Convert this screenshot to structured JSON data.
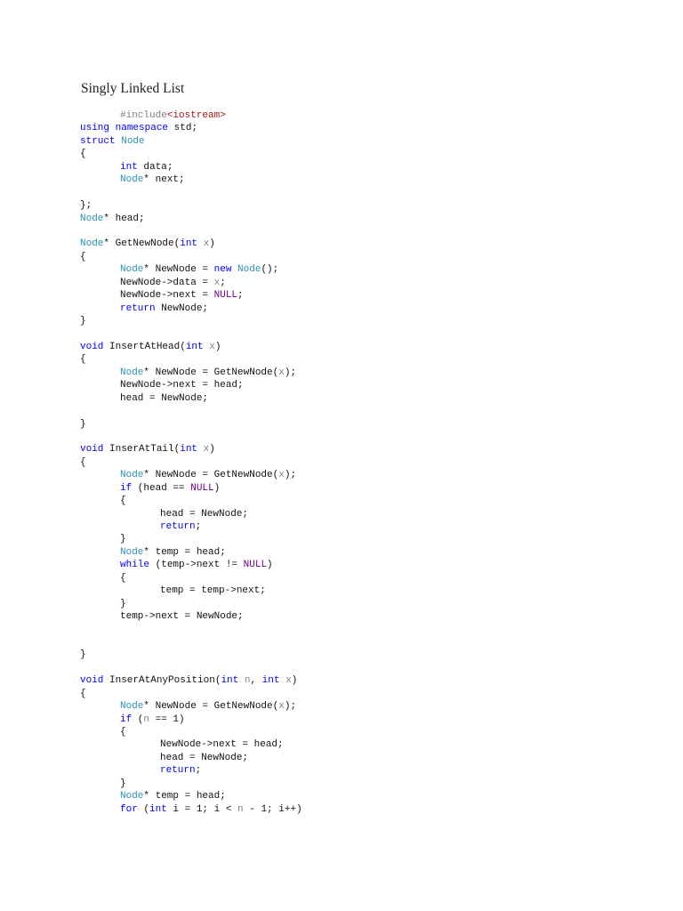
{
  "document": {
    "title": "Singly Linked List",
    "code_lines": [
      {
        "i": 1,
        "s": [
          [
            "#include",
            "p"
          ],
          [
            "<iostream>",
            "s"
          ]
        ]
      },
      {
        "i": 0,
        "s": [
          [
            "using",
            "k"
          ],
          [
            " ",
            ""
          ],
          [
            "namespace",
            "k"
          ],
          [
            " std;",
            ""
          ]
        ]
      },
      {
        "i": 0,
        "s": [
          [
            "struct",
            "k"
          ],
          [
            " ",
            ""
          ],
          [
            "Node",
            "t"
          ]
        ]
      },
      {
        "i": 0,
        "s": [
          [
            "{",
            ""
          ]
        ]
      },
      {
        "i": 1,
        "s": [
          [
            "int",
            "k"
          ],
          [
            " data;",
            ""
          ]
        ]
      },
      {
        "i": 1,
        "s": [
          [
            "Node",
            "t"
          ],
          [
            "* next;",
            ""
          ]
        ]
      },
      {
        "i": 0,
        "s": []
      },
      {
        "i": 0,
        "s": [
          [
            "};",
            ""
          ]
        ]
      },
      {
        "i": 0,
        "s": [
          [
            "Node",
            "t"
          ],
          [
            "* head;",
            ""
          ]
        ]
      },
      {
        "i": 0,
        "s": []
      },
      {
        "i": 0,
        "s": [
          [
            "Node",
            "t"
          ],
          [
            "* GetNewNode(",
            ""
          ],
          [
            "int",
            "k"
          ],
          [
            " ",
            ""
          ],
          [
            "x",
            "v"
          ],
          [
            ")",
            ""
          ]
        ]
      },
      {
        "i": 0,
        "s": [
          [
            "{",
            ""
          ]
        ]
      },
      {
        "i": 1,
        "s": [
          [
            "Node",
            "t"
          ],
          [
            "* NewNode = ",
            ""
          ],
          [
            "new",
            "k"
          ],
          [
            " ",
            ""
          ],
          [
            "Node",
            "t"
          ],
          [
            "();",
            ""
          ]
        ]
      },
      {
        "i": 1,
        "s": [
          [
            "NewNode->data = ",
            ""
          ],
          [
            "x",
            "v"
          ],
          [
            ";",
            ""
          ]
        ]
      },
      {
        "i": 1,
        "s": [
          [
            "NewNode->next = ",
            ""
          ],
          [
            "NULL",
            "m"
          ],
          [
            ";",
            ""
          ]
        ]
      },
      {
        "i": 1,
        "s": [
          [
            "return",
            "k"
          ],
          [
            " NewNode;",
            ""
          ]
        ]
      },
      {
        "i": 0,
        "s": [
          [
            "}",
            ""
          ]
        ]
      },
      {
        "i": 0,
        "s": []
      },
      {
        "i": 0,
        "s": [
          [
            "void",
            "k"
          ],
          [
            " InsertAtHead(",
            ""
          ],
          [
            "int",
            "k"
          ],
          [
            " ",
            ""
          ],
          [
            "x",
            "v"
          ],
          [
            ")",
            ""
          ]
        ]
      },
      {
        "i": 0,
        "s": [
          [
            "{",
            ""
          ]
        ]
      },
      {
        "i": 1,
        "s": [
          [
            "Node",
            "t"
          ],
          [
            "* NewNode = GetNewNode(",
            ""
          ],
          [
            "x",
            "v"
          ],
          [
            ");",
            ""
          ]
        ]
      },
      {
        "i": 1,
        "s": [
          [
            "NewNode->next = head;",
            ""
          ]
        ]
      },
      {
        "i": 1,
        "s": [
          [
            "head = NewNode;",
            ""
          ]
        ]
      },
      {
        "i": 0,
        "s": []
      },
      {
        "i": 0,
        "s": [
          [
            "}",
            ""
          ]
        ]
      },
      {
        "i": 0,
        "s": []
      },
      {
        "i": 0,
        "s": [
          [
            "void",
            "k"
          ],
          [
            " InserAtTail(",
            ""
          ],
          [
            "int",
            "k"
          ],
          [
            " ",
            ""
          ],
          [
            "x",
            "v"
          ],
          [
            ")",
            ""
          ]
        ]
      },
      {
        "i": 0,
        "s": [
          [
            "{",
            ""
          ]
        ]
      },
      {
        "i": 1,
        "s": [
          [
            "Node",
            "t"
          ],
          [
            "* NewNode = GetNewNode(",
            ""
          ],
          [
            "x",
            "v"
          ],
          [
            ");",
            ""
          ]
        ]
      },
      {
        "i": 1,
        "s": [
          [
            "if",
            "k"
          ],
          [
            " (head == ",
            ""
          ],
          [
            "NULL",
            "m"
          ],
          [
            ")",
            ""
          ]
        ]
      },
      {
        "i": 1,
        "s": [
          [
            "{",
            ""
          ]
        ]
      },
      {
        "i": 2,
        "s": [
          [
            "head = NewNode;",
            ""
          ]
        ]
      },
      {
        "i": 2,
        "s": [
          [
            "return",
            "k"
          ],
          [
            ";",
            ""
          ]
        ]
      },
      {
        "i": 1,
        "s": [
          [
            "}",
            ""
          ]
        ]
      },
      {
        "i": 1,
        "s": [
          [
            "Node",
            "t"
          ],
          [
            "* temp = head;",
            ""
          ]
        ]
      },
      {
        "i": 1,
        "s": [
          [
            "while",
            "k"
          ],
          [
            " (temp->next != ",
            ""
          ],
          [
            "NULL",
            "m"
          ],
          [
            ")",
            ""
          ]
        ]
      },
      {
        "i": 1,
        "s": [
          [
            "{",
            ""
          ]
        ]
      },
      {
        "i": 2,
        "s": [
          [
            "temp = temp->next;",
            ""
          ]
        ]
      },
      {
        "i": 1,
        "s": [
          [
            "}",
            ""
          ]
        ]
      },
      {
        "i": 1,
        "s": [
          [
            "temp->next = NewNode;",
            ""
          ]
        ]
      },
      {
        "i": 0,
        "s": []
      },
      {
        "i": 0,
        "s": []
      },
      {
        "i": 0,
        "s": [
          [
            "}",
            ""
          ]
        ]
      },
      {
        "i": 0,
        "s": []
      },
      {
        "i": 0,
        "s": [
          [
            "void",
            "k"
          ],
          [
            " InserAtAnyPosition(",
            ""
          ],
          [
            "int",
            "k"
          ],
          [
            " ",
            ""
          ],
          [
            "n",
            "v"
          ],
          [
            ", ",
            ""
          ],
          [
            "int",
            "k"
          ],
          [
            " ",
            ""
          ],
          [
            "x",
            "v"
          ],
          [
            ")",
            ""
          ]
        ]
      },
      {
        "i": 0,
        "s": [
          [
            "{",
            ""
          ]
        ]
      },
      {
        "i": 1,
        "s": [
          [
            "Node",
            "t"
          ],
          [
            "* NewNode = GetNewNode(",
            ""
          ],
          [
            "x",
            "v"
          ],
          [
            ");",
            ""
          ]
        ]
      },
      {
        "i": 1,
        "s": [
          [
            "if",
            "k"
          ],
          [
            " (",
            ""
          ],
          [
            "n",
            "v"
          ],
          [
            " == 1)",
            ""
          ]
        ]
      },
      {
        "i": 1,
        "s": [
          [
            "{",
            ""
          ]
        ]
      },
      {
        "i": 2,
        "s": [
          [
            "NewNode->next = head;",
            ""
          ]
        ]
      },
      {
        "i": 2,
        "s": [
          [
            "head = NewNode;",
            ""
          ]
        ]
      },
      {
        "i": 2,
        "s": [
          [
            "return",
            "k"
          ],
          [
            ";",
            ""
          ]
        ]
      },
      {
        "i": 1,
        "s": [
          [
            "}",
            ""
          ]
        ]
      },
      {
        "i": 1,
        "s": [
          [
            "Node",
            "t"
          ],
          [
            "* temp = head;",
            ""
          ]
        ]
      },
      {
        "i": 1,
        "s": [
          [
            "for",
            "k"
          ],
          [
            " (",
            ""
          ],
          [
            "int",
            "k"
          ],
          [
            " i = 1; i < ",
            ""
          ],
          [
            "n",
            "v"
          ],
          [
            " - 1; i++)",
            ""
          ]
        ]
      }
    ]
  },
  "colors": {
    "keyword": "#0000ff",
    "type": "#2b91af",
    "preprocessor": "#808080",
    "string": "#a31515",
    "parameter": "#808080",
    "macro": "#6f008a"
  }
}
